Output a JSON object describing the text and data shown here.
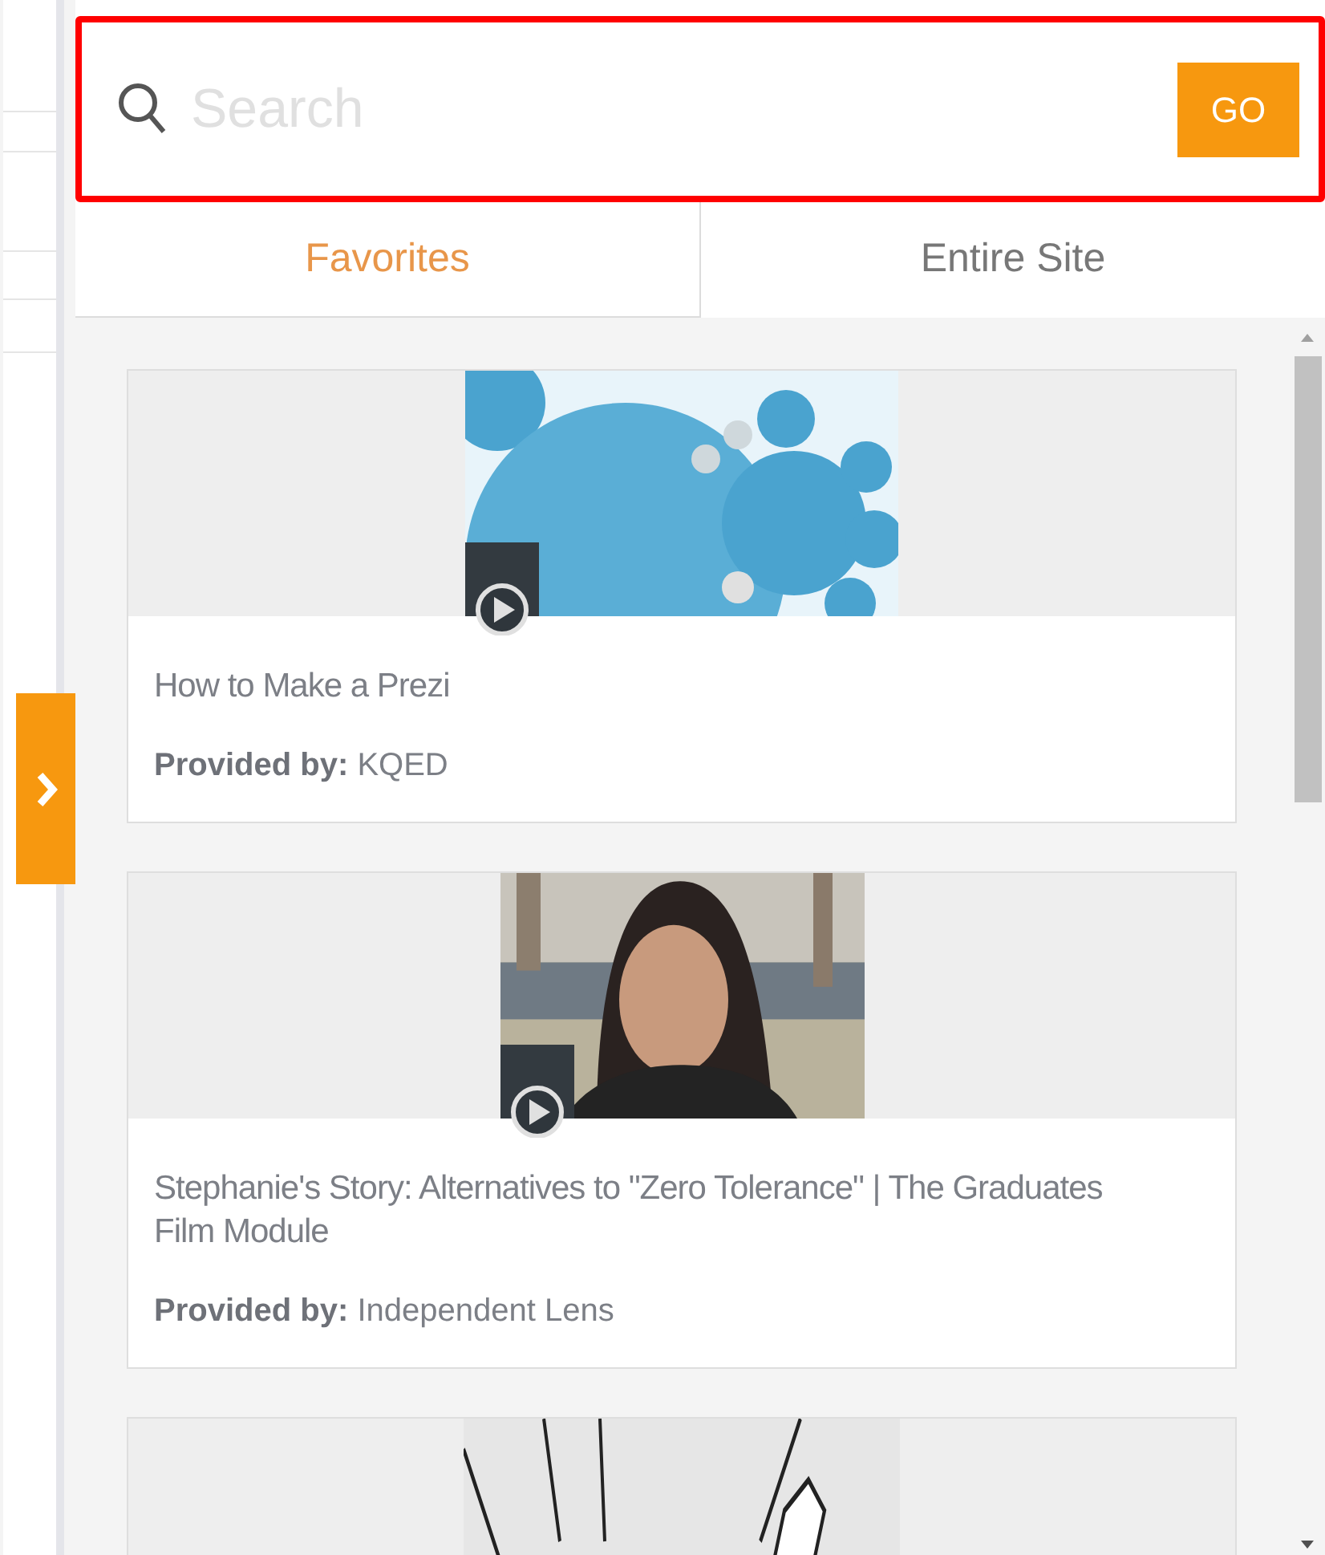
{
  "search": {
    "placeholder": "Search",
    "highlighted": true,
    "button": "GO"
  },
  "tabs": [
    {
      "label": "Favorites",
      "selected": true
    },
    {
      "label": "Entire Site",
      "selected": false
    }
  ],
  "cards": [
    {
      "video": true,
      "title": "How to Make a Prezi",
      "provider": "**Provided by:** KQED"
    },
    {
      "video": true,
      "title": "Stephanie's Story: Alternatives to \"Zero Tolerance\" | The Graduates Film Module",
      "provider": "**Provided by:** Independent Lens"
    },
    {
      "video": false
    }
  ]
}
